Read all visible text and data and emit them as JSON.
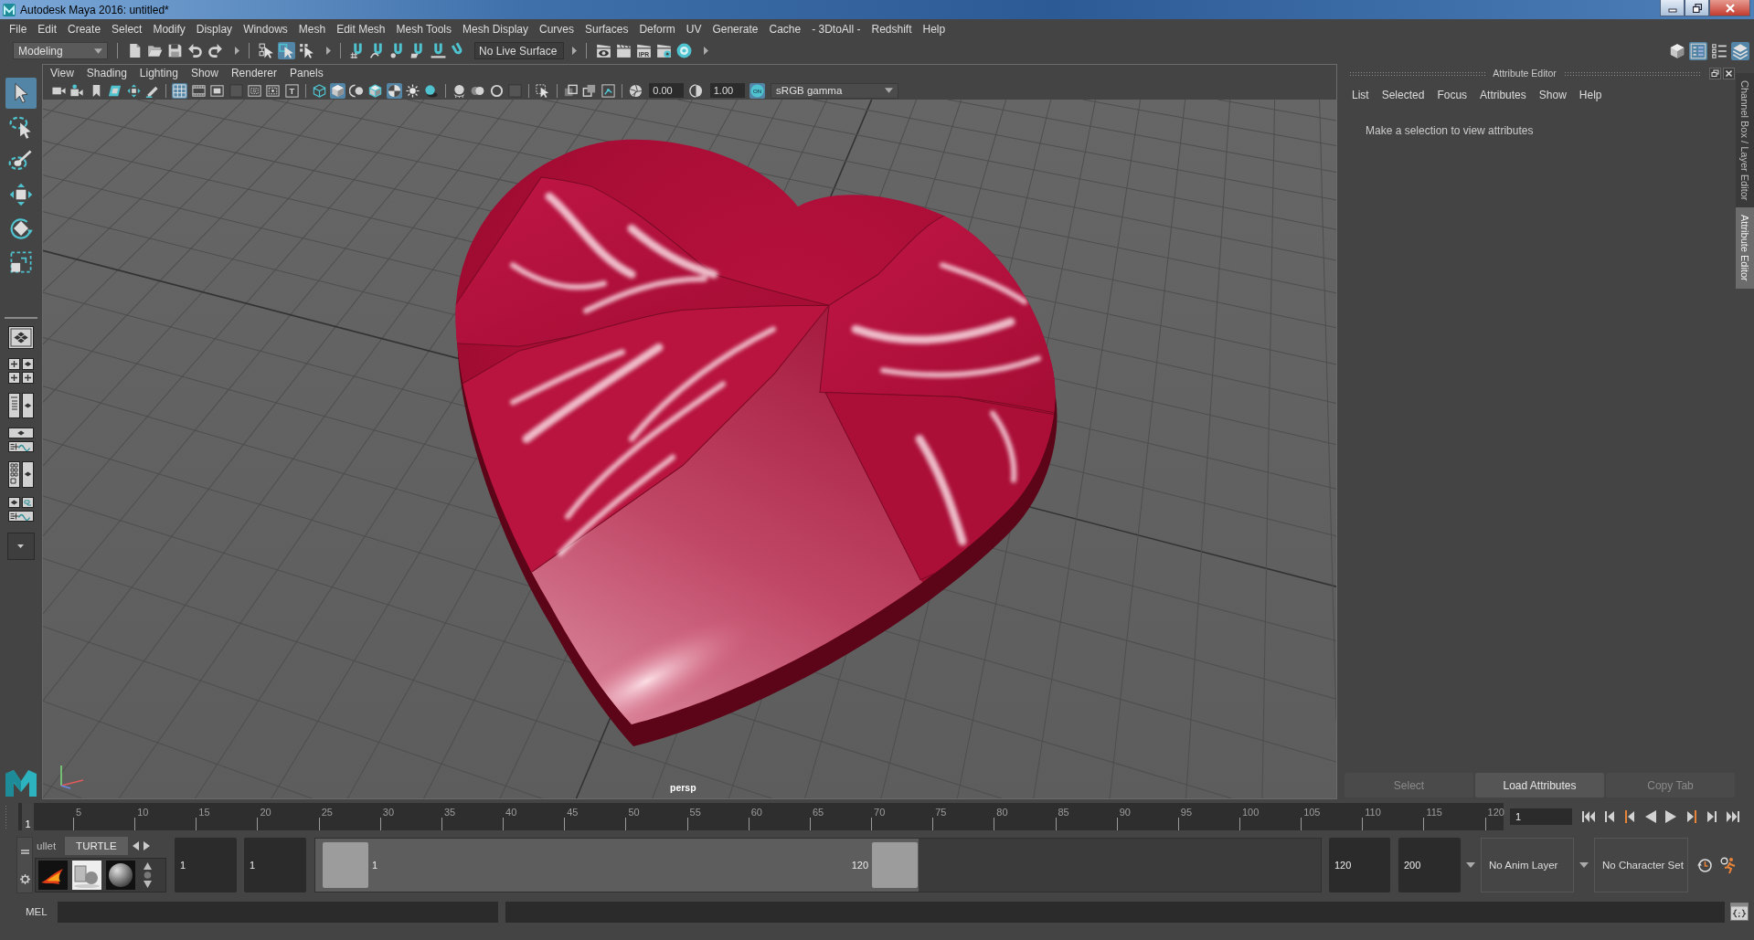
{
  "window": {
    "title": "Autodesk Maya 2016: untitled*"
  },
  "menu_bar": [
    "File",
    "Edit",
    "Create",
    "Select",
    "Modify",
    "Display",
    "Windows",
    "Mesh",
    "Edit Mesh",
    "Mesh Tools",
    "Mesh Display",
    "Curves",
    "Surfaces",
    "Deform",
    "UV",
    "Generate",
    "Cache",
    "- 3DtoAll -",
    "Redshift",
    "Help"
  ],
  "status_line": {
    "menu_set": "Modeling",
    "tool_groups": [
      [
        {
          "kind": "new-scene",
          "on": false
        },
        {
          "kind": "open-scene",
          "on": false
        },
        {
          "kind": "save-scene",
          "on": false
        },
        {
          "kind": "undo",
          "on": false
        },
        {
          "kind": "redo",
          "on": false
        }
      ],
      [
        {
          "kind": "select-hierarchy",
          "on": false
        },
        {
          "kind": "select-object",
          "on": true
        },
        {
          "kind": "select-component",
          "on": false
        }
      ],
      [
        {
          "kind": "snap-grid",
          "on": false
        },
        {
          "kind": "snap-curve",
          "on": false
        },
        {
          "kind": "snap-point",
          "on": false
        },
        {
          "kind": "snap-view-plane",
          "on": false
        },
        {
          "kind": "snap-surface",
          "on": false
        },
        {
          "kind": "make-live",
          "on": false
        }
      ]
    ],
    "live_surface": "No Live Surface",
    "render_tools": [
      {
        "kind": "render-view",
        "on": false
      },
      {
        "kind": "render",
        "on": false
      },
      {
        "kind": "ipr",
        "on": false,
        "label": "IPR"
      },
      {
        "kind": "render-settings",
        "on": false
      },
      {
        "kind": "hypershade",
        "on": false
      }
    ],
    "panel_toggles": [
      {
        "kind": "modeling-toolkit",
        "on": false
      },
      {
        "kind": "attribute-editor",
        "on": true
      },
      {
        "kind": "tool-settings",
        "on": false
      },
      {
        "kind": "channel-box",
        "on": true
      }
    ]
  },
  "toolbox": {
    "tools": [
      {
        "kind": "select",
        "selected": true
      },
      {
        "kind": "lasso",
        "selected": false
      },
      {
        "kind": "paint-select",
        "selected": false
      },
      {
        "kind": "move",
        "selected": false
      },
      {
        "kind": "rotate",
        "selected": false
      },
      {
        "kind": "scale",
        "selected": false
      }
    ]
  },
  "viewport": {
    "menu": [
      "View",
      "Shading",
      "Lighting",
      "Show",
      "Renderer",
      "Panels"
    ],
    "toolbar_groups": [
      [
        {
          "kind": "camera",
          "on": false
        },
        {
          "kind": "camera-attributes",
          "on": false
        },
        {
          "kind": "bookmark",
          "on": false
        },
        {
          "kind": "image-plane",
          "on": false
        },
        {
          "kind": "pan-zoom",
          "on": false
        },
        {
          "kind": "grease-pencil",
          "on": false
        }
      ],
      [
        {
          "kind": "grid",
          "on": true
        },
        {
          "kind": "film-gate",
          "on": false
        },
        {
          "kind": "resolution-gate",
          "on": false
        },
        {
          "kind": "gate-mask",
          "on": false
        },
        {
          "kind": "field-chart",
          "on": false
        },
        {
          "kind": "safe-action",
          "on": false
        },
        {
          "kind": "safe-title",
          "on": false,
          "label": "T"
        }
      ],
      [
        {
          "kind": "wireframe",
          "on": false
        },
        {
          "kind": "smooth-shade",
          "on": true
        },
        {
          "kind": "default-material",
          "on": false
        },
        {
          "kind": "wireframe-on-shaded",
          "on": false
        },
        {
          "kind": "textured",
          "on": true
        },
        {
          "kind": "lights",
          "on": false
        },
        {
          "kind": "shadows",
          "on": false
        }
      ],
      [
        {
          "kind": "ambient-occlusion",
          "on": false
        },
        {
          "kind": "motion-blur",
          "on": false
        },
        {
          "kind": "anti-aliasing",
          "on": false
        },
        {
          "kind": "depth-of-field",
          "on": false
        }
      ],
      [
        {
          "kind": "isolate-select",
          "on": false
        }
      ],
      [
        {
          "kind": "xray",
          "on": false
        },
        {
          "kind": "xray-components",
          "on": false
        },
        {
          "kind": "xray-joints",
          "on": false
        }
      ]
    ],
    "exposure": "0.00",
    "gamma": "1.00",
    "color_management": {
      "label": "ON",
      "on": true
    },
    "color_space": "sRGB gamma",
    "camera": "persp"
  },
  "attribute_editor": {
    "title": "Attribute Editor",
    "menu": [
      "List",
      "Selected",
      "Focus",
      "Attributes",
      "Show",
      "Help"
    ],
    "message": "Make a selection to view attributes",
    "buttons": [
      {
        "label": "Select",
        "disabled": true
      },
      {
        "label": "Load Attributes",
        "disabled": false
      },
      {
        "label": "Copy Tab",
        "disabled": true
      }
    ]
  },
  "side_tabs": [
    {
      "label": "Channel Box / Layer Editor",
      "selected": false
    },
    {
      "label": "Attribute Editor",
      "selected": true
    }
  ],
  "timeline": {
    "current_marker": "1",
    "level": 0,
    "ticks": [
      "5",
      "10",
      "15",
      "20",
      "25",
      "30",
      "35",
      "40",
      "45",
      "50",
      "55",
      "60",
      "65",
      "70",
      "75",
      "80",
      "85",
      "90",
      "95",
      "100",
      "105",
      "110",
      "115",
      "120"
    ],
    "current_frame": "1"
  },
  "shelf": {
    "tabs": [
      {
        "label": "ullet",
        "selected": false
      },
      {
        "label": "TURTLE",
        "selected": true
      }
    ]
  },
  "range": {
    "animation_start": "1",
    "playback_start": "1",
    "range_start": "1",
    "range_end": "120",
    "level": 0.6,
    "playback_end": "120",
    "animation_end": "200"
  },
  "anim_layer": "No Anim Layer",
  "character_set": "No Character Set",
  "command_line": {
    "language": "MEL"
  }
}
